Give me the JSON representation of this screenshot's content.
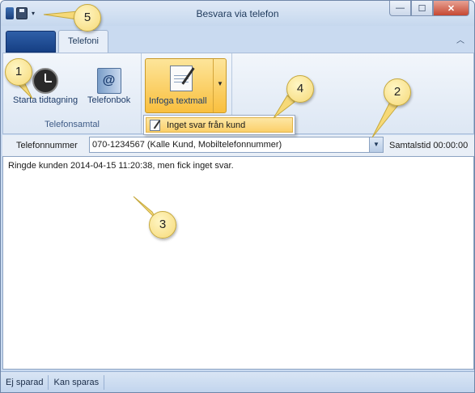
{
  "window": {
    "title": "Besvara via telefon",
    "min_icon": "—",
    "max_icon": "☐",
    "close_icon": "✕",
    "qat_dropdown": "▾"
  },
  "tabs": {
    "file_label": "",
    "active": "Telefoni",
    "collapse": "︿"
  },
  "ribbon": {
    "group_telefonsamtal": {
      "label": "Telefonsamtal",
      "start_timer": "Starta tidtagning",
      "phonebook": "Telefonbok"
    },
    "insert_template": "Infoga textmall",
    "split_arrow": "▼"
  },
  "menu": {
    "item": "Inget svar från kund"
  },
  "phone": {
    "label": "Telefonnummer",
    "value": "070-1234567 (Kalle Kund, Mobiltelefonnummer)",
    "duration": "Samtalstid 00:00:00",
    "combo_arrow": "▼"
  },
  "notes": {
    "text": "Ringde kunden 2014-04-15 11:20:38, men fick inget svar."
  },
  "status": {
    "saved": "Ej sparad",
    "can_save": "Kan sparas"
  },
  "callouts": [
    "1",
    "2",
    "3",
    "4",
    "5"
  ],
  "colors": {
    "accent": "#f9bf3e",
    "window_frame": "#c9daf0",
    "callout": "#f6d978"
  }
}
